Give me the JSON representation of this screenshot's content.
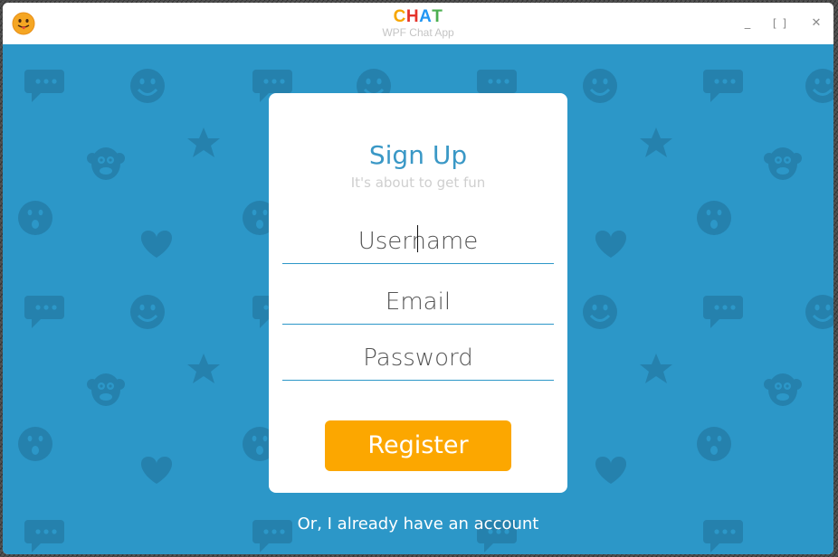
{
  "window": {
    "title_letters": [
      {
        "char": "C",
        "color": "#f7a600"
      },
      {
        "char": "H",
        "color": "#e5332a"
      },
      {
        "char": "A",
        "color": "#2196f3"
      },
      {
        "char": "T",
        "color": "#4caf50"
      }
    ],
    "subtitle": "WPF Chat App",
    "controls": {
      "minimize": "_",
      "maximize": "[ ]",
      "close": "✕"
    }
  },
  "signup": {
    "title": "Sign Up",
    "subtitle": "It's about to get fun",
    "username_placeholder": "Username",
    "email_placeholder": "Email",
    "password_placeholder": "Password",
    "register_label": "Register",
    "login_link": "Or, I already have an account"
  },
  "colors": {
    "background": "#2c97c8",
    "pattern": "#2581ad",
    "accent": "#3a98c6",
    "button": "#fca700"
  },
  "icons": [
    "smile-icon",
    "chat-bubble-icon",
    "star-icon",
    "heart-icon",
    "surprised-icon",
    "monkey-icon"
  ]
}
